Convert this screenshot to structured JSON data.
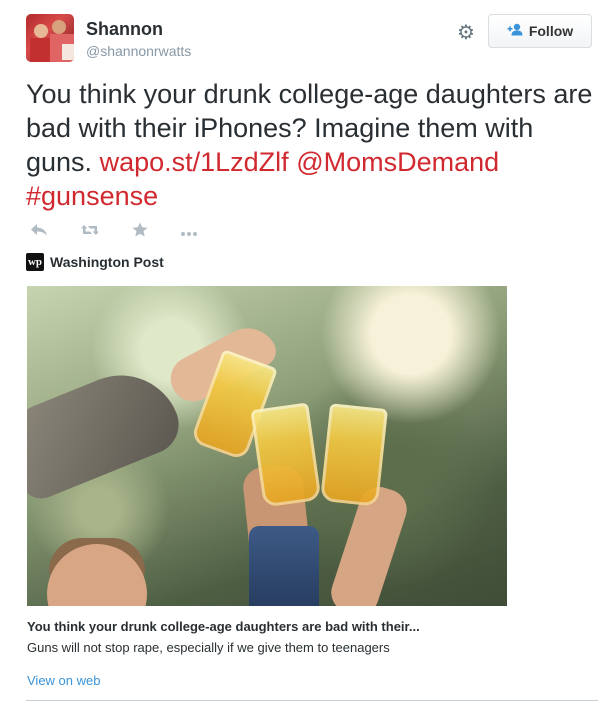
{
  "author": {
    "name": "Shannon",
    "handle": "@shannonrwatts"
  },
  "header": {
    "follow_label": "Follow",
    "icons": {
      "settings": "gear-icon",
      "follow": "add-user-icon"
    }
  },
  "tweet": {
    "text": "You think your drunk college-age daughters are bad with their iPhones? Imagine them with guns.",
    "link": "wapo.st/1LzdZlf",
    "mention": "@MomsDemand",
    "hashtag": "#gunsense",
    "colors": {
      "link": "#d0292f",
      "text": "#292f33"
    }
  },
  "actions": {
    "icons": [
      "reply-icon",
      "retweet-icon",
      "favorite-icon",
      "more-icon"
    ]
  },
  "card": {
    "source_logo": "wp",
    "source_name": "Washington Post",
    "title": "You think your drunk college-age daughters are bad with their...",
    "description": "Guns will not stop rape, especially if we give them to teenagers",
    "view_on_web": "View on web",
    "colors": {
      "view_on_web": "#3b94d9"
    }
  }
}
